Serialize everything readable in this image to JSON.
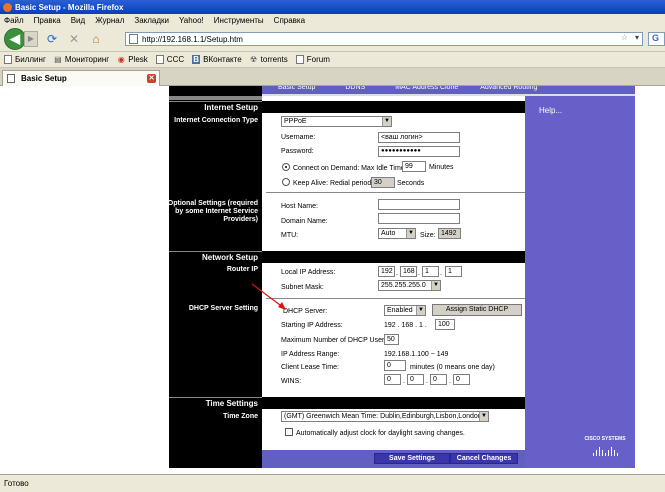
{
  "window": {
    "title": "Basic Setup - Mozilla Firefox"
  },
  "menu": [
    "Файл",
    "Правка",
    "Вид",
    "Журнал",
    "Закладки",
    "Yahoo!",
    "Инструменты",
    "Справка"
  ],
  "nav": {
    "url": "http://192.168.1.1/Setup.htm",
    "search_logo": "G"
  },
  "bookmarks": [
    "Биллинг",
    "Мониторинг",
    "Plesk",
    "CCC",
    "ВКонтакте",
    "torrents",
    "Forum"
  ],
  "tab": {
    "label": "Basic Setup"
  },
  "status": "Готово",
  "topnav": [
    "Basic Setup",
    "DDNS",
    "MAC Address Clone",
    "Advanced Routing"
  ],
  "help": "Help...",
  "internet": {
    "section": "Internet Setup",
    "conn_type_label": "Internet Connection Type",
    "conn_type": "PPPoE",
    "username_label": "Username:",
    "username": "<ваш логин>",
    "password_label": "Password:",
    "password": "●●●●●●●●●●●",
    "connect_demand": "Connect on Demand: Max Idle Time",
    "idle_time": "99",
    "minutes": "Minutes",
    "keep_alive": "Keep Alive: Redial period",
    "redial": "30",
    "seconds": "Seconds",
    "optional_label": "Optional Settings (required by some Internet Service Providers)",
    "host_label": "Host Name:",
    "domain_label": "Domain Name:",
    "mtu_label": "MTU:",
    "mtu_mode": "Auto",
    "size_label": "Size:",
    "size": "1492"
  },
  "network": {
    "section": "Network Setup",
    "router_ip": "Router IP",
    "local_ip_label": "Local IP Address:",
    "ip": [
      "192",
      "168",
      "1",
      "1"
    ],
    "subnet_label": "Subnet Mask:",
    "subnet": "255.255.255.0",
    "dhcp_label": "DHCP Server Setting",
    "dhcp_server_label": "DHCP Server:",
    "dhcp_server": "Enabled",
    "assign_static": "Assign Static DHCP",
    "start_ip_label": "Starting IP Address:",
    "start_ip_prefix": "192 . 168 . 1 .",
    "start_ip": "100",
    "max_users_label": "Maximum Number of DHCP Users:",
    "max_users": "50",
    "range_label": "IP Address Range:",
    "range": "192.168.1.100 ~ 149",
    "lease_label": "Client Lease Time:",
    "lease": "0",
    "lease_unit": "minutes (0 means one day)",
    "wins_label": "WINS:",
    "wins": [
      "0",
      "0",
      "0",
      "0"
    ]
  },
  "time": {
    "section": "Time Settings",
    "zone_label": "Time Zone",
    "zone": "(GMT) Greenwich Mean Time: Dublin,Edinburgh,Lisbon,London",
    "dst": "Automatically adjust clock for daylight saving changes."
  },
  "buttons": {
    "save": "Save Settings",
    "cancel": "Cancel Changes"
  },
  "brand": "CISCO SYSTEMS"
}
